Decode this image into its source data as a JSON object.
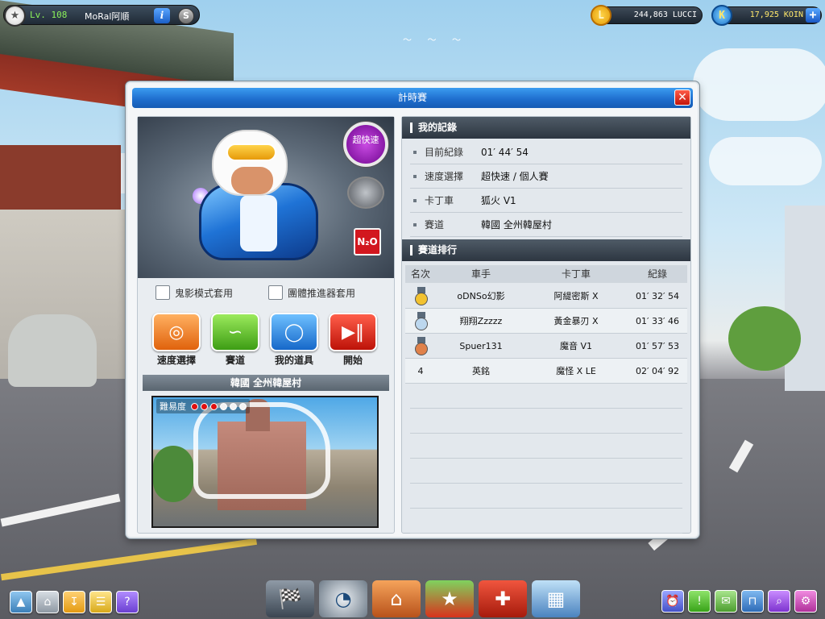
{
  "player": {
    "level": "Lv. 108",
    "name": "MoRal阿順",
    "info_label": "i",
    "s_label": "S"
  },
  "currency": {
    "lucci": {
      "amount": "244,863 LUCCI",
      "icon": "L"
    },
    "koin": {
      "amount": "17,925 KOIN",
      "icon": "K",
      "add_label": "+"
    }
  },
  "dialog": {
    "title": "計時賽",
    "close_label": "✕",
    "speed_badge": "超快速",
    "n2o_label": "N₂O",
    "options": [
      {
        "label": "鬼影模式套用",
        "checked": false
      },
      {
        "label": "團體推進器套用",
        "checked": false
      }
    ],
    "actions": [
      {
        "label": "速度選擇",
        "icon": "speed-gauge-icon",
        "color": "#f07a1a"
      },
      {
        "label": "賽道",
        "icon": "track-icon",
        "color": "#58b52a"
      },
      {
        "label": "我的道具",
        "icon": "item-icon",
        "color": "#2a8be0"
      },
      {
        "label": "開始",
        "icon": "play-pause-icon",
        "color": "#d8231a"
      }
    ],
    "track_name": "韓國 全州韓屋村",
    "difficulty_label": "難易度",
    "difficulty": {
      "level": 3,
      "max": 5
    }
  },
  "my_record": {
    "header": "我的記錄",
    "rows": [
      {
        "key": "目前紀錄",
        "value": "01′ 44′ 54"
      },
      {
        "key": "速度選擇",
        "value": "超快速 / 個人賽"
      },
      {
        "key": "卡丁車",
        "value": "狐火 V1"
      },
      {
        "key": "賽道",
        "value": "韓國 全州韓屋村"
      }
    ]
  },
  "ranking": {
    "header": "賽道排行",
    "columns": [
      "名次",
      "車手",
      "卡丁車",
      "紀錄"
    ],
    "rows": [
      {
        "rank": "1",
        "medal": "gold",
        "racer": "oDNSo幻影",
        "kart": "阿緹密斯 X",
        "time": "01′ 32′ 54"
      },
      {
        "rank": "2",
        "medal": "silver",
        "racer": "翔翔Zzzzz",
        "kart": "黃金暴刃 X",
        "time": "01′ 33′ 46"
      },
      {
        "rank": "3",
        "medal": "bronze",
        "racer": "Spuer131",
        "kart": "魔音 V1",
        "time": "01′ 57′ 53"
      },
      {
        "rank": "4",
        "medal": "",
        "racer": "英銘",
        "kart": "魔怪 X LE",
        "time": "02′ 04′ 92"
      }
    ],
    "empty_rows": 6
  },
  "colors": {
    "title_bar": "#1f6fcf",
    "close": "#c1150a",
    "gold": "#f2c230",
    "silver": "#bcd7ee",
    "bronze": "#e0814a"
  },
  "bottom_left_icons": [
    "inventory-icon",
    "home-icon",
    "download-icon",
    "notes-icon",
    "help-icon"
  ],
  "bottom_menu_icons": [
    "kart-garage-icon",
    "speedometer-icon",
    "shop-icon",
    "market-icon",
    "toolbox-icon",
    "building-icon"
  ],
  "bottom_right_icons": [
    "alarm-icon",
    "alert-icon",
    "chat-icon",
    "board-icon",
    "search-icon",
    "settings-icon"
  ]
}
